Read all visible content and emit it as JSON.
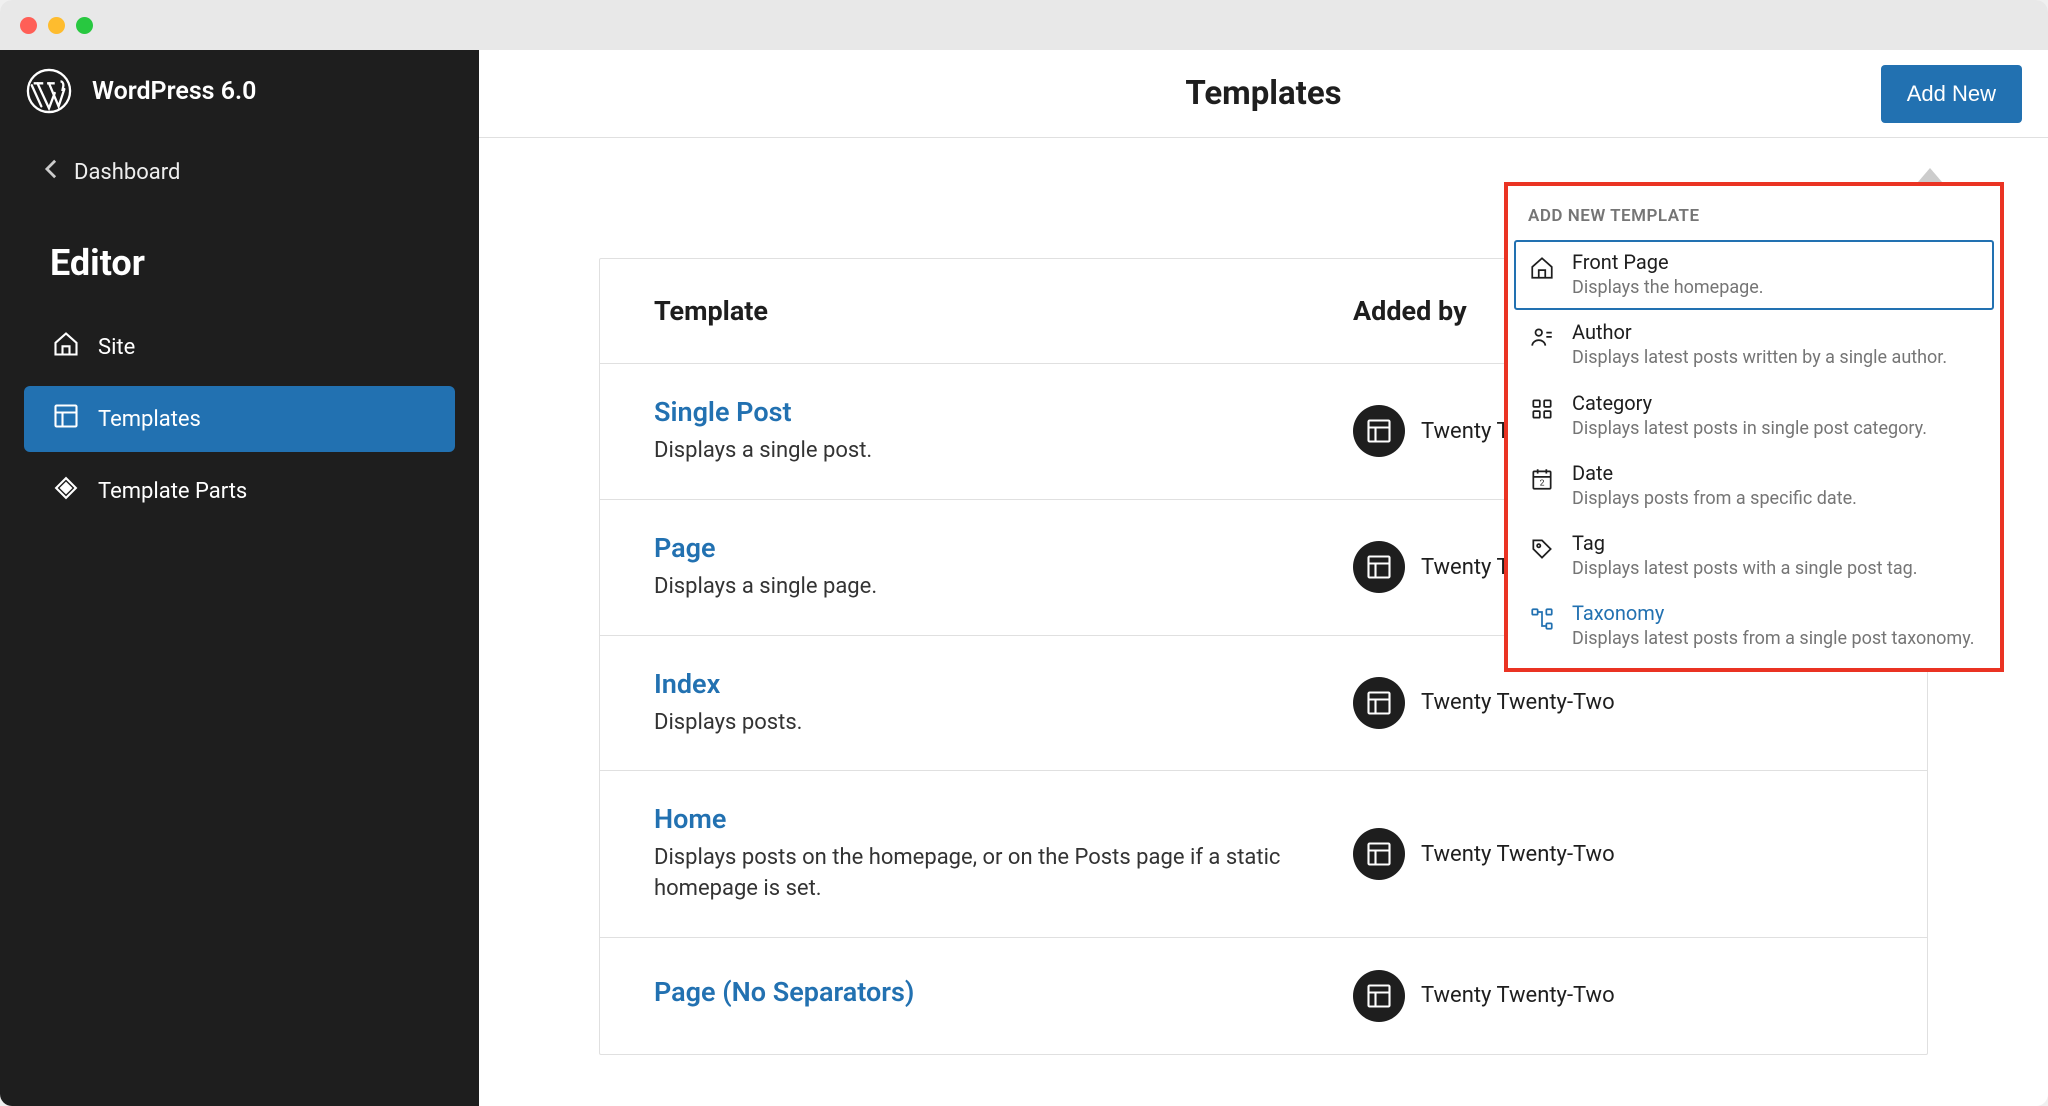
{
  "app": {
    "title": "WordPress 6.0"
  },
  "sidebar": {
    "back_label": "Dashboard",
    "heading": "Editor",
    "nav": [
      {
        "label": "Site"
      },
      {
        "label": "Templates"
      },
      {
        "label": "Template Parts"
      }
    ]
  },
  "topbar": {
    "title": "Templates",
    "add_new_label": "Add New"
  },
  "table": {
    "headers": {
      "template": "Template",
      "added_by": "Added by"
    },
    "rows": [
      {
        "name": "Single Post",
        "desc": "Displays a single post.",
        "theme": "Twenty Twenty-Two"
      },
      {
        "name": "Page",
        "desc": "Displays a single page.",
        "theme": "Twenty Twenty-Two"
      },
      {
        "name": "Index",
        "desc": "Displays posts.",
        "theme": "Twenty Twenty-Two"
      },
      {
        "name": "Home",
        "desc": "Displays posts on the homepage, or on the Posts page if a static homepage is set.",
        "theme": "Twenty Twenty-Two"
      },
      {
        "name": "Page (No Separators)",
        "desc": "",
        "theme": "Twenty Twenty-Two"
      }
    ]
  },
  "dropdown": {
    "heading": "Add New Template",
    "items": [
      {
        "title": "Front Page",
        "desc": "Displays the homepage."
      },
      {
        "title": "Author",
        "desc": "Displays latest posts written by a single author."
      },
      {
        "title": "Category",
        "desc": "Displays latest posts in single post category."
      },
      {
        "title": "Date",
        "desc": "Displays posts from a specific date."
      },
      {
        "title": "Tag",
        "desc": "Displays latest posts with a single post tag."
      },
      {
        "title": "Taxonomy",
        "desc": "Displays latest posts from a single post taxonomy."
      }
    ]
  }
}
